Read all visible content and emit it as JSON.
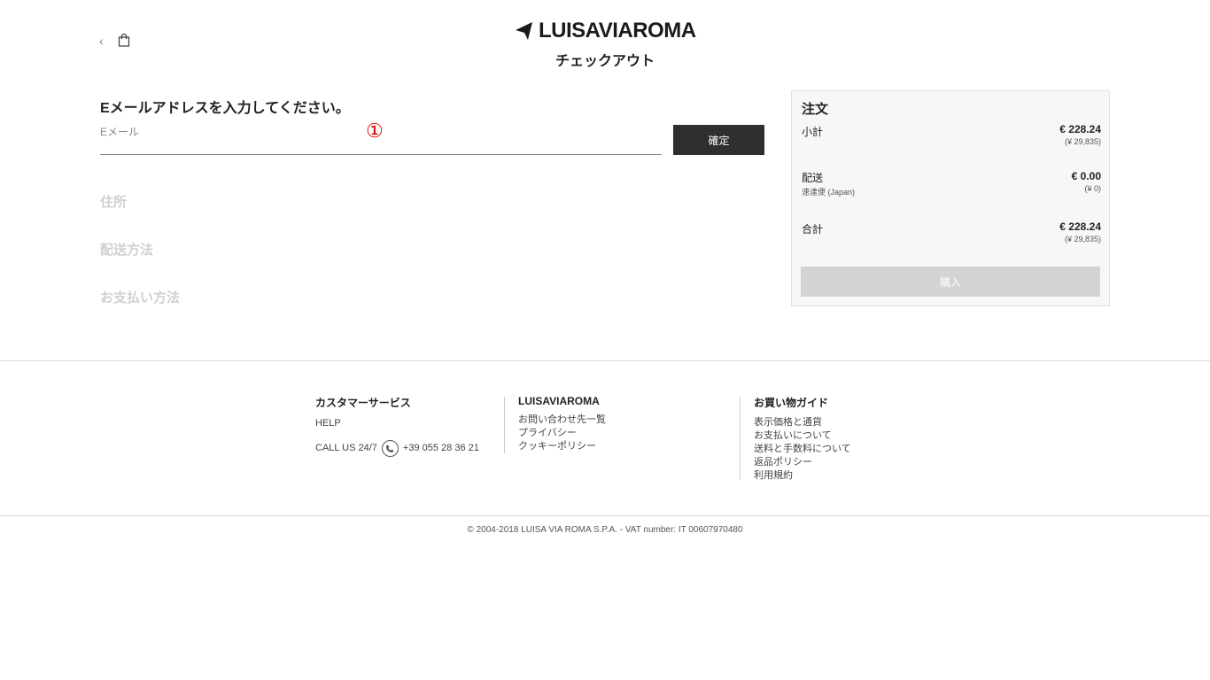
{
  "header": {
    "logo_text": "LUISAVIAROMA",
    "page_title": "チェックアウト",
    "back_icon": "‹",
    "bag_icon": "shopping-bag-icon"
  },
  "email_section": {
    "heading": "Eメールアドレスを入力してください。",
    "field_label": "Eメール",
    "field_value": "",
    "confirm_label": "確定",
    "annotation": "①"
  },
  "steps": [
    "住所",
    "配送方法",
    "お支払い方法"
  ],
  "order": {
    "title": "注文",
    "subtotal_label": "小計",
    "subtotal_value": "€ 228.24",
    "subtotal_yen": "(¥ 29,835)",
    "shipping_label": "配送",
    "shipping_method": "速達便 (Japan)",
    "shipping_value": "€ 0.00",
    "shipping_yen": "(¥ 0)",
    "total_label": "合計",
    "total_value": "€ 228.24",
    "total_yen": "(¥ 29,835)",
    "buy_label": "購入"
  },
  "footer": {
    "customer_service": {
      "heading": "カスタマーサービス",
      "help": "HELP",
      "call_label": "CALL US 24/7",
      "phone": "+39 055 28 36 21"
    },
    "brand": {
      "heading": "LUISAVIAROMA",
      "links": [
        "お問い合わせ先一覧",
        "プライバシー",
        "クッキーポリシー"
      ]
    },
    "guide": {
      "heading": "お買い物ガイド",
      "links": [
        "表示価格と通貨",
        "お支払いについて",
        "送料と手数料について",
        "返品ポリシー",
        "利用規約"
      ]
    },
    "copyright": "© 2004-2018 LUISA VIA ROMA S.P.A. - VAT number: IT 00607970480"
  },
  "colors": {
    "button_dark": "#2f2f2f",
    "button_disabled": "#d3d3d3",
    "inactive_step": "#d0d0d0",
    "annotation_red": "#dd0000"
  }
}
